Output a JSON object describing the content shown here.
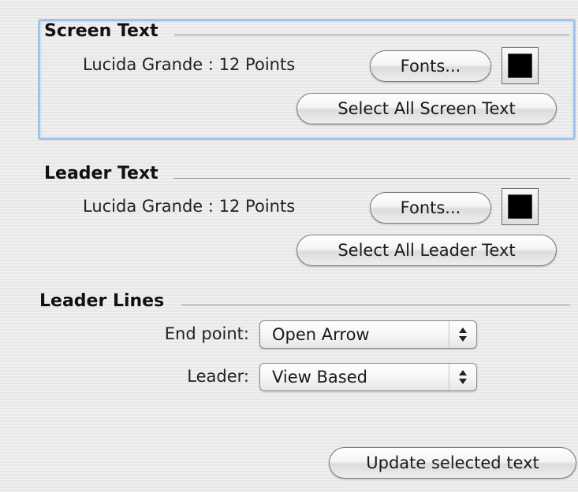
{
  "screen_text": {
    "title": "Screen Text",
    "font_description": "Lucida Grande : 12 Points",
    "fonts_button": "Fonts...",
    "color": "#000000",
    "select_all_button": "Select All Screen Text"
  },
  "leader_text": {
    "title": "Leader Text",
    "font_description": "Lucida Grande : 12 Points",
    "fonts_button": "Fonts...",
    "color": "#000000",
    "select_all_button": "Select All Leader Text"
  },
  "leader_lines": {
    "title": "Leader Lines",
    "end_point": {
      "label": "End point:",
      "value": "Open Arrow",
      "icon": "updown-arrows-icon"
    },
    "leader": {
      "label": "Leader:",
      "value": "View Based",
      "icon": "updown-arrows-icon"
    }
  },
  "actions": {
    "update_button": "Update selected text"
  },
  "colors": {
    "focus_ring": "#9ec4ec",
    "background": "#ededed"
  }
}
